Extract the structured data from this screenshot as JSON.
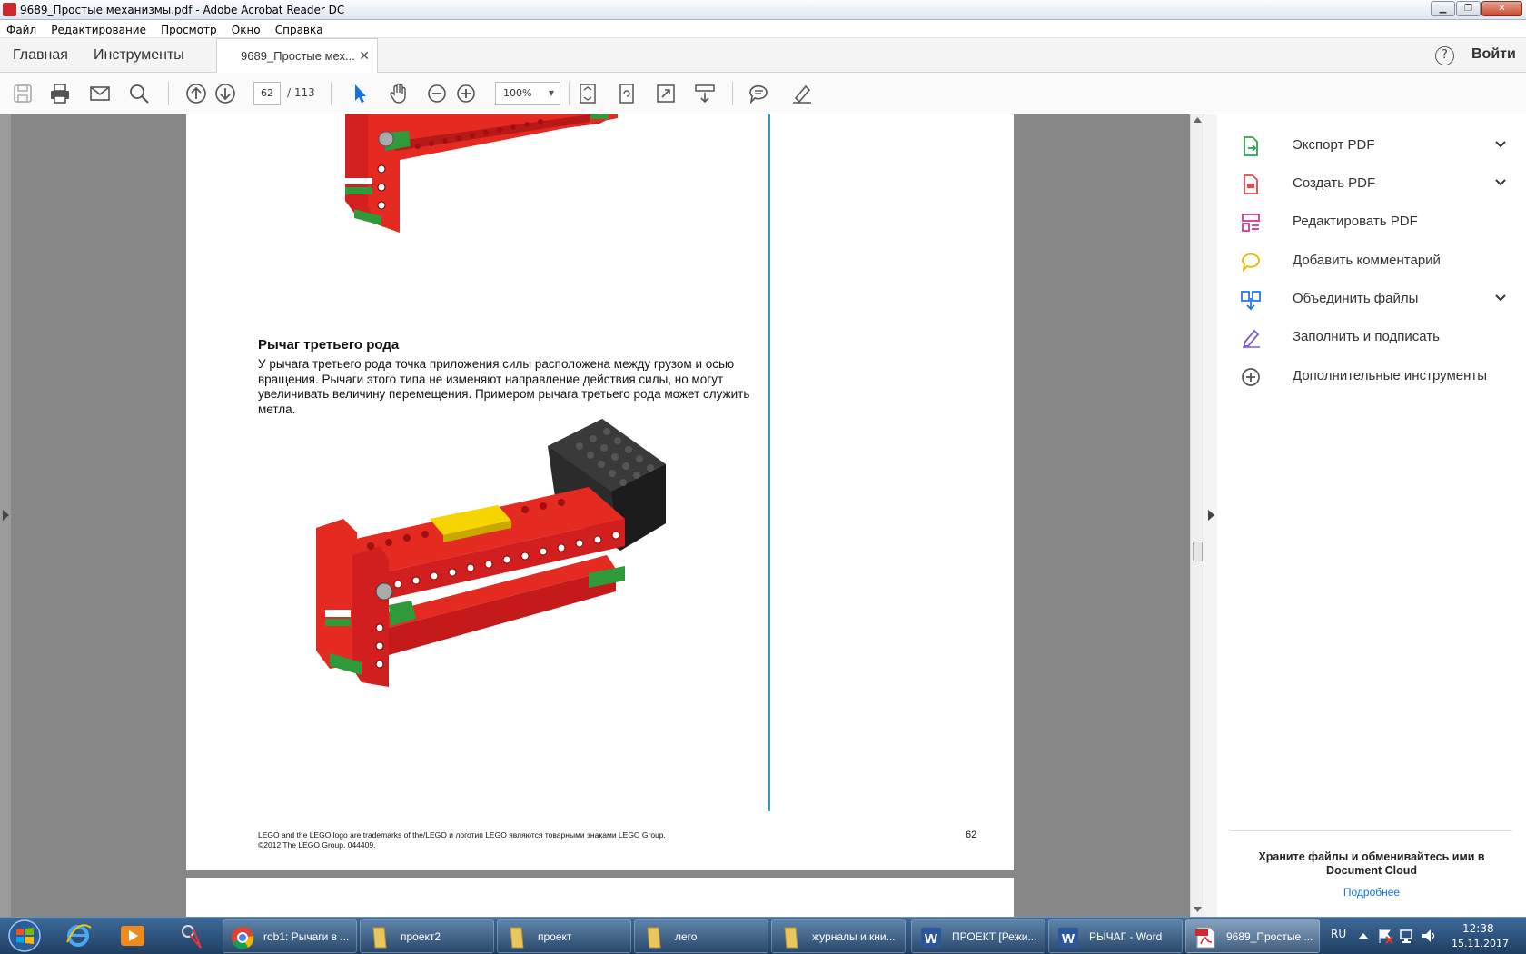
{
  "window": {
    "title": "9689_Простые механизмы.pdf - Adobe Acrobat Reader DC"
  },
  "menu": [
    "Файл",
    "Редактирование",
    "Просмотр",
    "Окно",
    "Справка"
  ],
  "tabs": {
    "home": "Главная",
    "tools": "Инструменты",
    "doc": "9689_Простые мех...",
    "login": "Войти",
    "help": "?"
  },
  "toolbar": {
    "page_current": "62",
    "page_total": "/ 113",
    "zoom": "100%"
  },
  "document": {
    "heading": "Рычаг третьего рода",
    "body": "У рычага третьего рода точка приложения силы расположена между грузом и осью вращения. Рычаги этого типа не изменяют направление действия силы, но могут увеличивать величину перемещения. Примером рычага третьего рода может служить метла.",
    "footer_line1": "LEGO and the LEGO logo are trademarks of the/LEGO и логотип LEGO являются товарными знаками LEGO Group.",
    "footer_line2": "©2012 The LEGO Group. 044409.",
    "page_number": "62"
  },
  "right_panel": {
    "items": [
      {
        "label": "Экспорт PDF",
        "icon": "export-pdf-icon",
        "color": "#2da44e",
        "expandable": true
      },
      {
        "label": "Создать PDF",
        "icon": "create-pdf-icon",
        "color": "#e34850",
        "expandable": true
      },
      {
        "label": "Редактировать PDF",
        "icon": "edit-pdf-icon",
        "color": "#d83790",
        "expandable": false
      },
      {
        "label": "Добавить комментарий",
        "icon": "comment-icon",
        "color": "#e6b800",
        "expandable": false
      },
      {
        "label": "Объединить файлы",
        "icon": "combine-files-icon",
        "color": "#1473e6",
        "expandable": true
      },
      {
        "label": "Заполнить и подписать",
        "icon": "fill-sign-icon",
        "color": "#7b5cd6",
        "expandable": false
      },
      {
        "label": "Дополнительные инструменты",
        "icon": "more-tools-icon",
        "color": "#555555",
        "expandable": false
      }
    ],
    "cloud_line1": "Храните файлы и обменивайтесь ими в",
    "cloud_line2": "Document Cloud",
    "cloud_link": "Подробнее"
  },
  "taskbar": {
    "buttons": [
      {
        "label": "rob1: Рычаги в ...",
        "icon": "chrome-icon"
      },
      {
        "label": "проект2",
        "icon": "folder-icon"
      },
      {
        "label": "проект",
        "icon": "folder-icon"
      },
      {
        "label": "лего",
        "icon": "folder-icon"
      },
      {
        "label": "журналы и кни...",
        "icon": "folder-icon"
      },
      {
        "label": "ПРОЕКТ [Режи...",
        "icon": "word-icon"
      },
      {
        "label": "РЫЧАГ - Word",
        "icon": "word-icon"
      },
      {
        "label": "9689_Простые ...",
        "icon": "acrobat-icon"
      }
    ],
    "lang": "RU",
    "time": "12:38",
    "date": "15.11.2017"
  }
}
